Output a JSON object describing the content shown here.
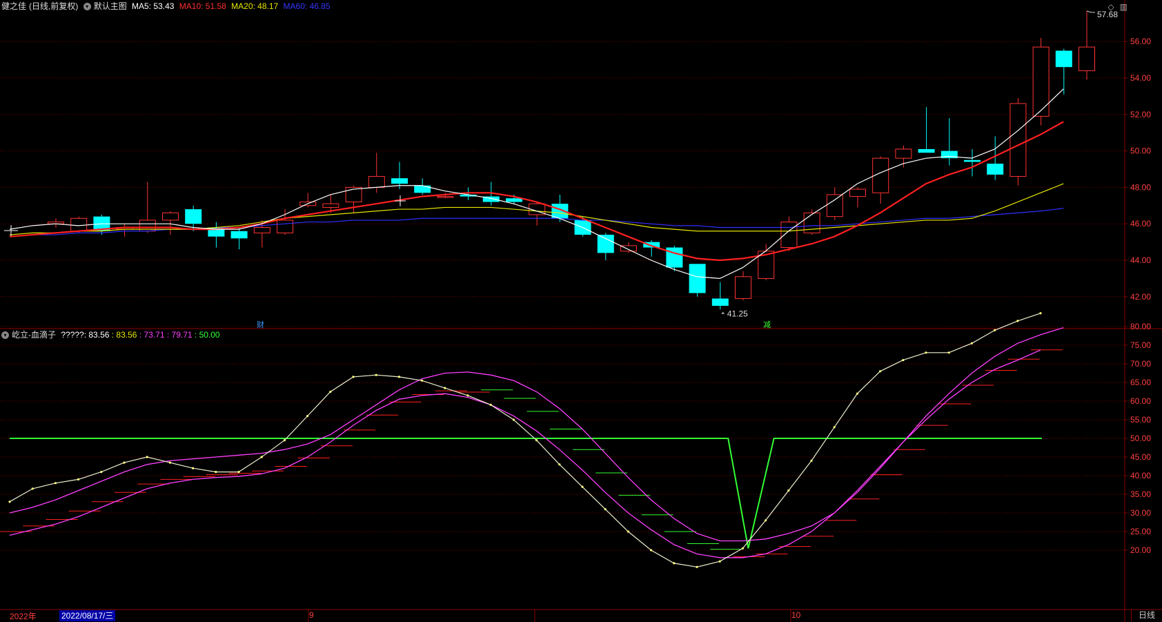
{
  "header": {
    "stock": "健之佳",
    "mode": "(日线,前复权)",
    "mode_btn": "默认主图",
    "ma5": "MA5: 53.43",
    "ma10": "MA10: 51.58",
    "ma20": "MA20: 48.17",
    "ma60": "MA60: 46.85"
  },
  "colors": {
    "up": "#ff3333",
    "down": "#00ffff",
    "ma5": "#ffffff",
    "ma10": "#ff2020",
    "ma20": "#e6e600",
    "ma60": "#3030ff",
    "grid": "#8b0000",
    "axis_text": "#ff4040"
  },
  "sub_header": {
    "name": "屹立-血滴子",
    "label": "?????: 83.56",
    "v1": ": 83.56",
    "v2": ": 73.71",
    "v3": ": 79.71",
    "v4": ": 50.00"
  },
  "markers": {
    "high": "57.68",
    "low": "41.25",
    "tag_cai": "财",
    "tag_jian": "减"
  },
  "bottom": {
    "year": "2022年",
    "date": "2022/08/17/三",
    "month9": "9",
    "month10": "10",
    "period": "日线"
  },
  "chart_data": [
    {
      "type": "candlestick",
      "yticks": [
        42.0,
        44.0,
        46.0,
        48.0,
        50.0,
        52.0,
        54.0,
        56.0
      ],
      "ylim": [
        41.0,
        57.68
      ],
      "candles": [
        [
          46.0,
          46.3,
          45.8,
          46.1
        ],
        [
          45.6,
          46.4,
          45.5,
          46.3
        ],
        [
          46.4,
          46.5,
          45.4,
          45.6
        ],
        [
          45.7,
          46.0,
          45.3,
          45.8
        ],
        [
          45.6,
          48.3,
          45.5,
          46.2
        ],
        [
          46.2,
          46.7,
          45.4,
          46.6
        ],
        [
          46.8,
          47.0,
          45.6,
          46.0
        ],
        [
          45.8,
          46.1,
          44.7,
          45.3
        ],
        [
          45.6,
          45.8,
          44.6,
          45.2
        ],
        [
          45.5,
          46.2,
          44.7,
          45.8
        ],
        [
          45.5,
          46.8,
          45.4,
          46.2
        ],
        [
          47.0,
          47.7,
          46.9,
          47.2
        ],
        [
          46.9,
          47.6,
          46.6,
          47.1
        ],
        [
          47.2,
          48.1,
          46.6,
          48.0
        ],
        [
          48.0,
          49.9,
          47.7,
          48.6
        ],
        [
          48.5,
          49.4,
          47.9,
          48.2
        ],
        [
          48.1,
          48.5,
          47.6,
          47.7
        ],
        [
          47.5,
          47.7,
          47.4,
          47.5
        ],
        [
          47.6,
          48.0,
          47.3,
          47.5
        ],
        [
          47.5,
          48.3,
          47.0,
          47.2
        ],
        [
          47.4,
          47.6,
          47.1,
          47.2
        ],
        [
          46.5,
          47.2,
          45.9,
          47.1
        ],
        [
          47.1,
          47.6,
          46.1,
          46.3
        ],
        [
          46.2,
          46.4,
          45.3,
          45.4
        ],
        [
          45.4,
          45.5,
          44.0,
          44.4
        ],
        [
          44.5,
          45.0,
          44.4,
          44.8
        ],
        [
          45.0,
          45.1,
          44.2,
          44.7
        ],
        [
          44.7,
          44.8,
          43.4,
          43.6
        ],
        [
          43.8,
          43.8,
          42.0,
          42.2
        ],
        [
          41.9,
          42.8,
          41.3,
          41.5
        ],
        [
          41.9,
          43.4,
          41.8,
          43.1
        ],
        [
          43.0,
          44.9,
          42.9,
          44.5
        ],
        [
          44.7,
          46.4,
          44.5,
          46.1
        ],
        [
          45.5,
          46.8,
          45.4,
          46.6
        ],
        [
          46.4,
          48.0,
          46.2,
          47.6
        ],
        [
          47.5,
          48.0,
          46.9,
          47.9
        ],
        [
          47.7,
          49.7,
          47.1,
          49.6
        ],
        [
          49.6,
          50.3,
          49.1,
          50.1
        ],
        [
          50.1,
          52.4,
          49.9,
          49.9
        ],
        [
          50.0,
          51.8,
          49.2,
          49.6
        ],
        [
          49.5,
          50.1,
          48.6,
          49.4
        ],
        [
          49.3,
          50.8,
          48.4,
          48.7
        ],
        [
          48.6,
          52.9,
          48.1,
          52.6
        ],
        [
          51.9,
          56.2,
          51.4,
          55.7
        ],
        [
          55.5,
          55.6,
          53.1,
          54.6
        ],
        [
          54.4,
          57.68,
          53.9,
          55.7
        ]
      ],
      "ma5": [
        45.7,
        45.9,
        46.0,
        45.9,
        46.0,
        46.0,
        46.0,
        46.0,
        45.8,
        45.7,
        45.7,
        46.0,
        46.5,
        47.1,
        47.6,
        47.9,
        48.0,
        48.1,
        48.1,
        47.8,
        47.6,
        47.4,
        47.1,
        46.7,
        46.3,
        45.8,
        45.2,
        44.6,
        44.0,
        43.5,
        43.1,
        43.0,
        43.6,
        44.5,
        45.6,
        46.5,
        47.3,
        48.2,
        48.8,
        49.3,
        49.6,
        49.7,
        49.6,
        50.1,
        51.1,
        52.2,
        53.4
      ],
      "ma10": [
        45.3,
        45.4,
        45.5,
        45.6,
        45.7,
        45.8,
        45.8,
        45.8,
        45.7,
        45.7,
        45.8,
        46.0,
        46.3,
        46.5,
        46.7,
        46.9,
        47.1,
        47.3,
        47.5,
        47.6,
        47.7,
        47.7,
        47.5,
        47.2,
        46.8,
        46.3,
        45.8,
        45.3,
        44.8,
        44.4,
        44.1,
        44.0,
        44.1,
        44.3,
        44.6,
        44.9,
        45.3,
        45.9,
        46.6,
        47.4,
        48.2,
        48.7,
        49.1,
        49.7,
        50.3,
        50.9,
        51.6
      ],
      "ma20": [
        45.4,
        45.5,
        45.5,
        45.6,
        45.6,
        45.7,
        45.7,
        45.7,
        45.7,
        45.8,
        45.9,
        46.1,
        46.3,
        46.4,
        46.5,
        46.6,
        46.7,
        46.8,
        46.8,
        46.9,
        46.9,
        46.9,
        46.8,
        46.7,
        46.6,
        46.4,
        46.2,
        46.0,
        45.8,
        45.7,
        45.6,
        45.6,
        45.6,
        45.6,
        45.6,
        45.7,
        45.8,
        45.9,
        46.0,
        46.1,
        46.2,
        46.2,
        46.3,
        46.7,
        47.2,
        47.7,
        48.2
      ],
      "ma60": [
        45.3,
        45.4,
        45.4,
        45.5,
        45.5,
        45.6,
        45.6,
        45.7,
        45.7,
        45.8,
        45.8,
        45.9,
        46.0,
        46.1,
        46.1,
        46.2,
        46.2,
        46.2,
        46.3,
        46.3,
        46.3,
        46.3,
        46.3,
        46.3,
        46.3,
        46.2,
        46.2,
        46.1,
        46.0,
        45.9,
        45.9,
        45.8,
        45.8,
        45.8,
        45.8,
        45.9,
        45.9,
        46.0,
        46.1,
        46.2,
        46.3,
        46.3,
        46.4,
        46.5,
        46.6,
        46.7,
        46.85
      ]
    },
    {
      "type": "line",
      "yticks": [
        20.0,
        25.0,
        30.0,
        35.0,
        40.0,
        45.0,
        50.0,
        55.0,
        60.0,
        65.0,
        70.0,
        75.0,
        80.0
      ],
      "ylim": [
        15,
        86
      ],
      "main_line": [
        33.0,
        36.5,
        38.0,
        39.0,
        41.0,
        43.5,
        45.0,
        43.5,
        42.0,
        41.0,
        41.0,
        45.0,
        49.5,
        56.0,
        62.5,
        66.5,
        67.0,
        66.5,
        65.5,
        63.5,
        61.5,
        59.0,
        55.0,
        49.5,
        43.0,
        37.0,
        31.0,
        25.0,
        20.0,
        16.5,
        15.5,
        17.0,
        20.5,
        28.0,
        36.0,
        44.0,
        53.0,
        62.0,
        68.0,
        71.0,
        73.0,
        73.0,
        75.5,
        79.0,
        81.5,
        83.56
      ],
      "upper_line": [
        30.0,
        31.5,
        33.5,
        36.0,
        38.5,
        41.0,
        43.0,
        44.0,
        44.5,
        45.0,
        45.5,
        46.0,
        47.0,
        48.5,
        51.0,
        55.0,
        59.0,
        63.0,
        66.0,
        67.5,
        67.8,
        67.0,
        65.5,
        62.5,
        58.0,
        52.5,
        46.0,
        39.5,
        33.5,
        28.5,
        24.5,
        22.5,
        22.5,
        23.0,
        24.5,
        26.5,
        30.0,
        35.5,
        42.0,
        49.0,
        56.0,
        62.0,
        67.5,
        72.0,
        75.5,
        77.8,
        79.71
      ],
      "lower_line": [
        24.0,
        25.5,
        27.0,
        29.0,
        31.5,
        34.0,
        36.5,
        38.0,
        39.0,
        39.5,
        39.8,
        40.5,
        42.0,
        45.0,
        49.0,
        53.5,
        57.5,
        60.5,
        61.5,
        62.0,
        61.0,
        59.0,
        56.0,
        52.0,
        47.0,
        41.5,
        35.5,
        30.0,
        25.5,
        21.5,
        19.0,
        18.0,
        18.0,
        19.0,
        21.5,
        25.0,
        30.0,
        36.0,
        42.5,
        49.0,
        55.0,
        60.5,
        65.0,
        68.5,
        71.0,
        73.71
      ],
      "base_line": 50.0,
      "dip": {
        "from_index": 31,
        "bottom_index": 32,
        "to_index": 33,
        "bottom_value": 20.5
      }
    }
  ]
}
